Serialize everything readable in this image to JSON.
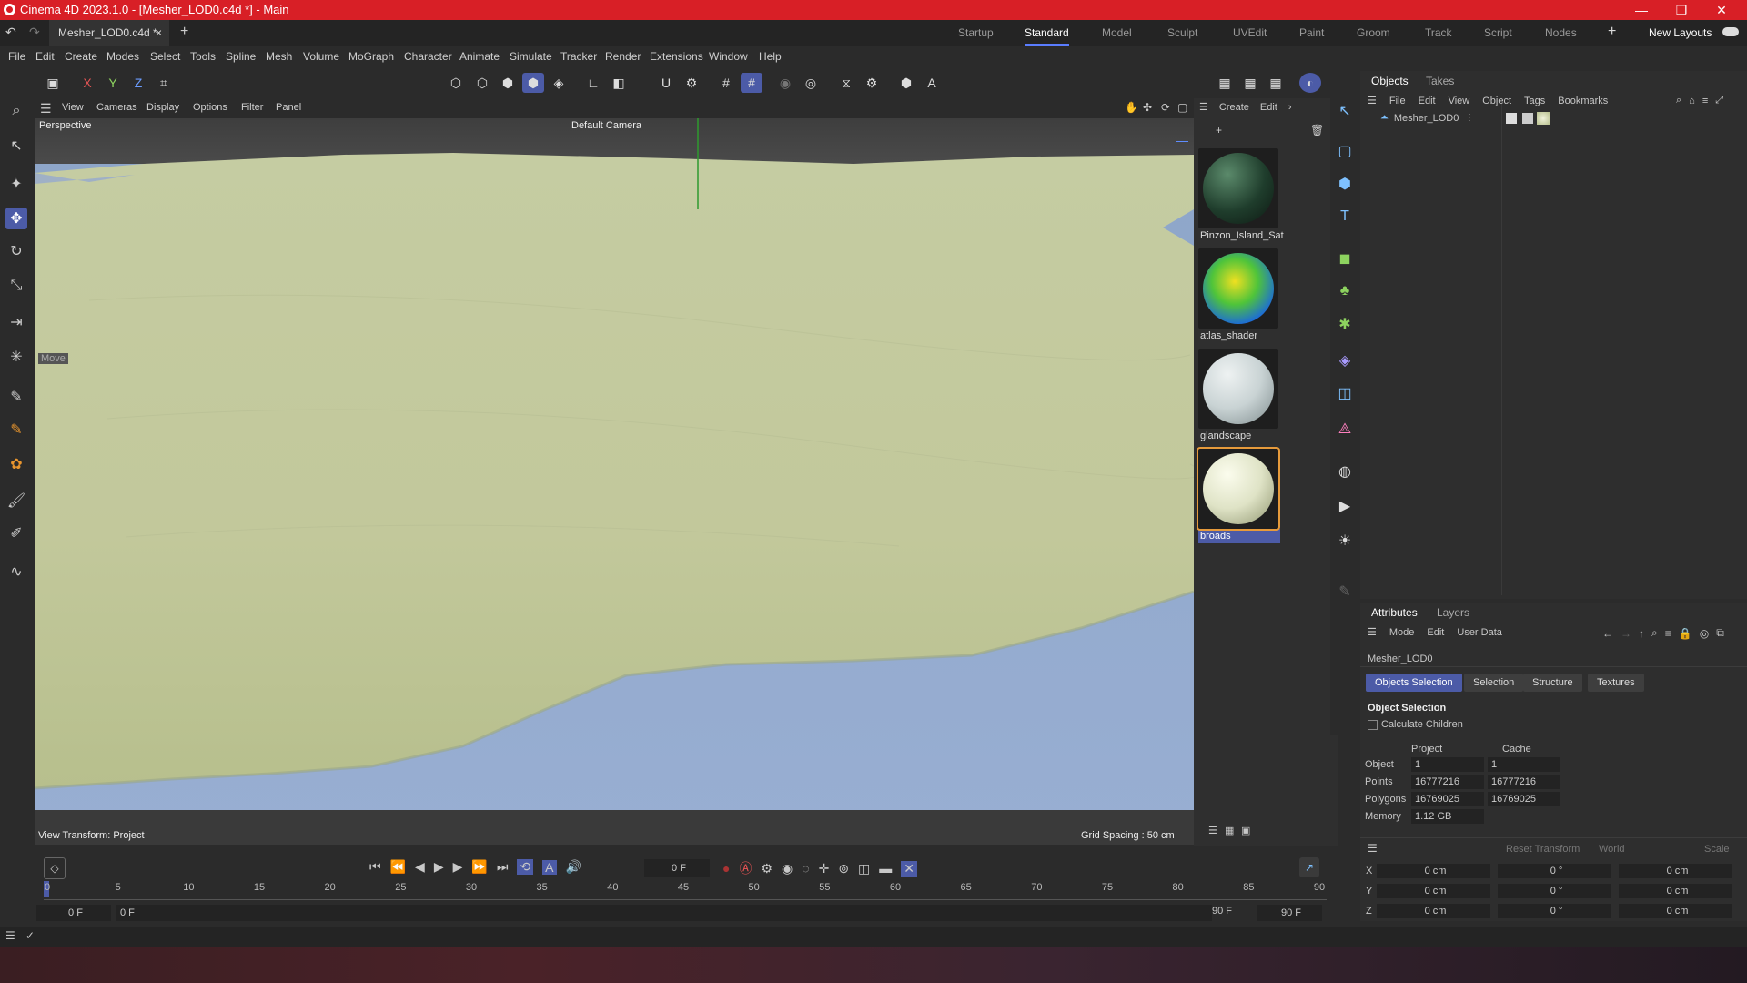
{
  "window": {
    "title": "Cinema 4D 2023.1.0 - [Mesher_LOD0.c4d *] - Main"
  },
  "doc_tab": {
    "label": "Mesher_LOD0.c4d *"
  },
  "layouts": [
    "Startup",
    "Standard",
    "Model",
    "Sculpt",
    "UVEdit",
    "Paint",
    "Groom",
    "Track",
    "Script",
    "Nodes"
  ],
  "new_layouts": "New Layouts",
  "menu": [
    "File",
    "Edit",
    "Create",
    "Modes",
    "Select",
    "Tools",
    "Spline",
    "Mesh",
    "Volume",
    "MoGraph",
    "Character",
    "Animate",
    "Simulate",
    "Tracker",
    "Render",
    "Extensions",
    "Window",
    "Help"
  ],
  "viewport": {
    "menu": [
      "View",
      "Cameras",
      "Display",
      "Options",
      "Filter",
      "Panel"
    ],
    "projection": "Perspective",
    "camera": "Default Camera",
    "move_label": "Move",
    "view_transform": "View Transform: Project",
    "grid_spacing": "Grid Spacing : 50 cm"
  },
  "materials": {
    "menu": [
      "Create",
      "Edit"
    ],
    "items": [
      {
        "name": "Pinzon_Island_Sat",
        "color": "#1f3d2c"
      },
      {
        "name": "atlas_shader",
        "color": "#4fc43a"
      },
      {
        "name": "glandscape",
        "color": "#c9d3d4"
      },
      {
        "name": "broads",
        "color": "#dfe3c6",
        "selected": true
      }
    ]
  },
  "objects": {
    "tabs": [
      "Objects",
      "Takes"
    ],
    "menu": [
      "File",
      "Edit",
      "View",
      "Object",
      "Tags",
      "Bookmarks"
    ],
    "items": [
      {
        "name": "Mesher_LOD0"
      }
    ]
  },
  "attributes": {
    "tabs": [
      "Attributes",
      "Layers"
    ],
    "menu": [
      "Mode",
      "Edit",
      "User Data"
    ],
    "object_name": "Mesher_LOD0",
    "sub_tabs": [
      "Objects Selection",
      "Selection",
      "Structure",
      "Textures"
    ],
    "section": "Object Selection",
    "calculate_children": "Calculate Children",
    "col_project": "Project",
    "col_cache": "Cache",
    "rows": [
      {
        "label": "Object",
        "project": "1",
        "cache": "1"
      },
      {
        "label": "Points",
        "project": "16777216",
        "cache": "16777216"
      },
      {
        "label": "Polygons",
        "project": "16769025",
        "cache": "16769025"
      },
      {
        "label": "Memory",
        "project": "1.12 GB",
        "cache": ""
      }
    ],
    "coords": {
      "reset": "Reset Transform",
      "world": "World",
      "scale": "Scale",
      "rows": [
        {
          "axis": "X",
          "pos": "0 cm",
          "rot": "0 °",
          "size": "0 cm"
        },
        {
          "axis": "Y",
          "pos": "0 cm",
          "rot": "0 °",
          "size": "0 cm"
        },
        {
          "axis": "Z",
          "pos": "0 cm",
          "rot": "0 °",
          "size": "0 cm"
        }
      ]
    }
  },
  "timeline": {
    "current_frame": "0 F",
    "start": "0 F",
    "start2": "0 F",
    "end": "90 F",
    "end2": "90 F",
    "ticks": [
      "0",
      "5",
      "10",
      "15",
      "20",
      "25",
      "30",
      "35",
      "40",
      "45",
      "50",
      "55",
      "60",
      "65",
      "70",
      "75",
      "80",
      "85",
      "90"
    ]
  }
}
